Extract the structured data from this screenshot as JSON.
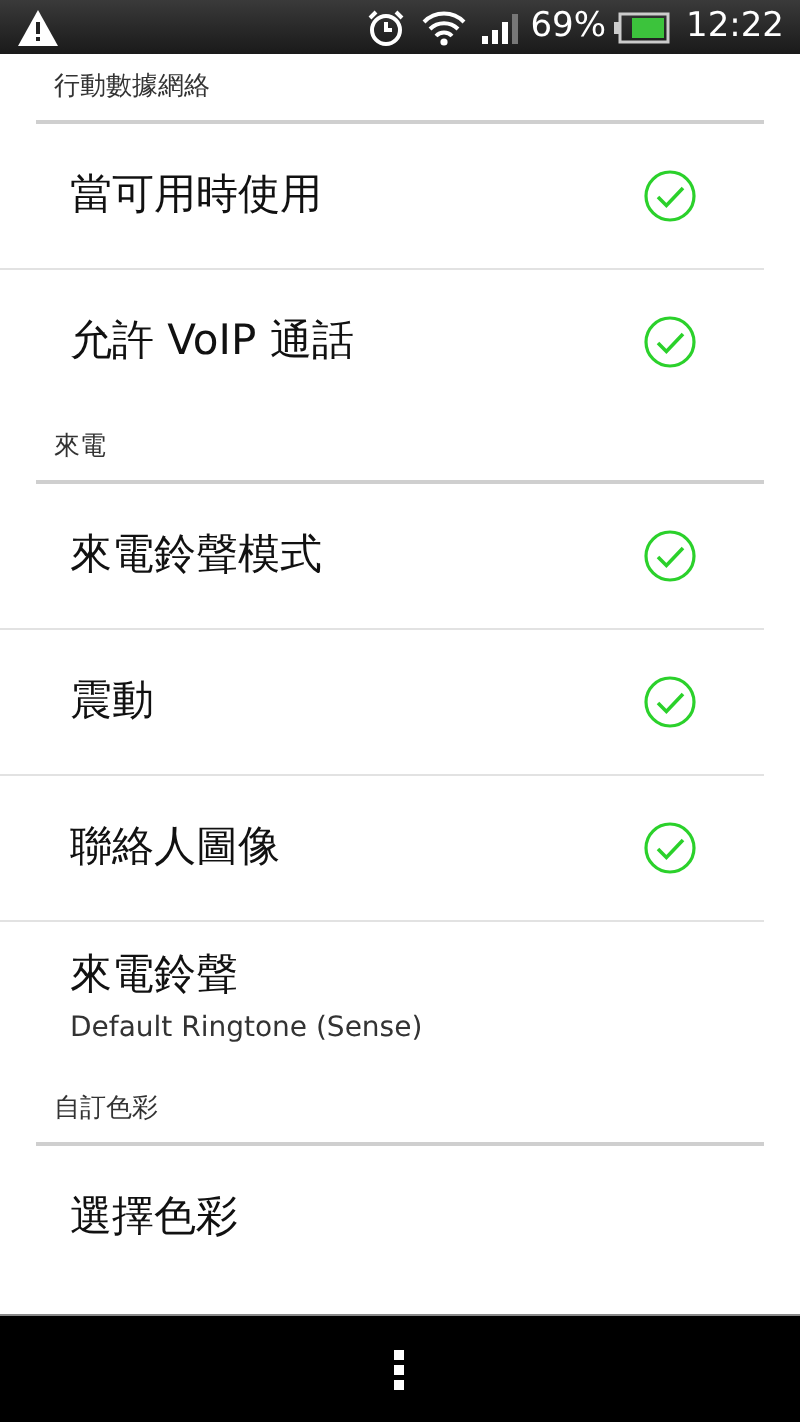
{
  "status_bar": {
    "battery": "69%",
    "time": "12:22"
  },
  "sections": [
    {
      "title": "行動數據網絡",
      "items": [
        {
          "kind": "check",
          "label": "當可用時使用",
          "checked": true
        },
        {
          "kind": "check",
          "label": "允許 VoIP 通話",
          "checked": true
        }
      ]
    },
    {
      "title": "來電",
      "items": [
        {
          "kind": "check",
          "label": "來電鈴聲模式",
          "checked": true
        },
        {
          "kind": "check",
          "label": "震動",
          "checked": true
        },
        {
          "kind": "check",
          "label": "聯絡人圖像",
          "checked": true
        },
        {
          "kind": "summary",
          "label": "來電鈴聲",
          "summary": "Default Ringtone (Sense)"
        }
      ]
    },
    {
      "title": "自訂色彩",
      "items": [
        {
          "kind": "plain",
          "label": "選擇色彩"
        }
      ]
    }
  ]
}
